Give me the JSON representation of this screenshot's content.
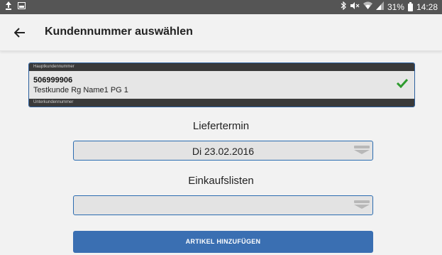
{
  "statusbar": {
    "left_icons": [
      "upload-icon",
      "image-icon"
    ],
    "right_icons": [
      "bluetooth-icon",
      "mute-icon",
      "wifi-icon",
      "signal-icon"
    ],
    "battery": "31%",
    "time": "14:28"
  },
  "appbar": {
    "back_icon": "arrow-left-icon",
    "title": "Kundennummer auswählen"
  },
  "customer": {
    "main_label": "Hauptkundennummer",
    "number": "506999906",
    "name": "Testkunde Rg Name1 PG 1",
    "sub_label": "Unterkundennummer",
    "selected_icon": "checkmark-icon",
    "check_color": "#2e9b2e"
  },
  "delivery": {
    "label": "Liefertermin",
    "value": "Di 23.02.2016"
  },
  "shopping_lists": {
    "label": "Einkaufslisten",
    "value": ""
  },
  "actions": {
    "add_article": "ARTIKEL HINZUFÜGEN"
  },
  "colors": {
    "accent": "#3a6fb2",
    "status_bar": "#555555"
  }
}
